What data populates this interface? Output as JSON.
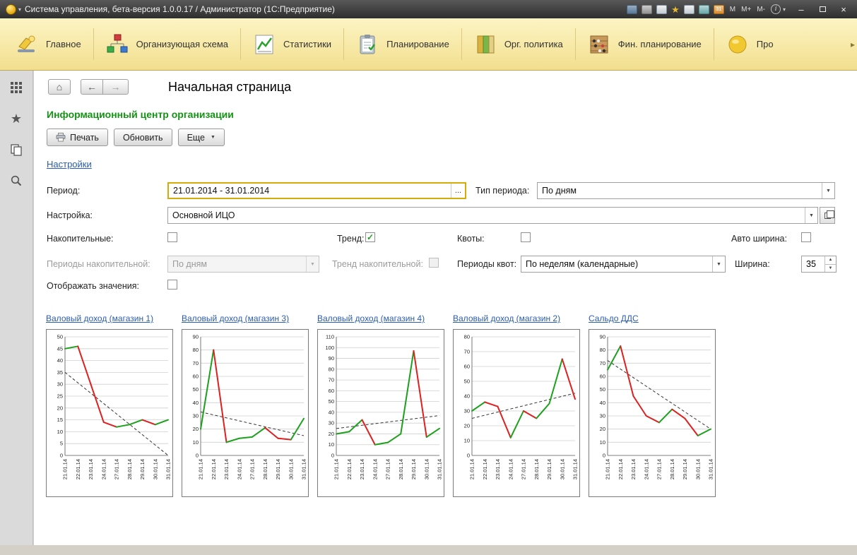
{
  "colors": {
    "heading_green": "#149414",
    "link_blue": "#2a5db0",
    "series_green": "#1ba11b",
    "series_red": "#e01f1f",
    "trend_dark": "#333333",
    "focus_yellow": "#d3ac0c"
  },
  "titlebar": {
    "title": "Система управления, бета-версия 1.0.0.17 / Администратор  (1С:Предприятие)",
    "calendar_day": "31",
    "memory_buttons": [
      "M",
      "M+",
      "M-"
    ],
    "minimize": "–",
    "close": "×"
  },
  "ribbon": {
    "items": [
      {
        "label": "Главное"
      },
      {
        "label": "Организующая схема"
      },
      {
        "label": "Статистики"
      },
      {
        "label": "Планирование"
      },
      {
        "label": "Орг. политика"
      },
      {
        "label": "Фин. планирование"
      },
      {
        "label": "Про"
      }
    ]
  },
  "nav": {
    "page_title": "Начальная страница"
  },
  "content": {
    "heading": "Информационный центр организации",
    "print_button": "Печать",
    "refresh_button": "Обновить",
    "more_button": "Еще",
    "settings_link": "Настройки"
  },
  "form": {
    "period": {
      "label": "Период:",
      "value": "21.01.2014 - 31.01.2014",
      "ellipsis": "..."
    },
    "period_type": {
      "label": "Тип периода:",
      "value": "По дням"
    },
    "setting": {
      "label": "Настройка:",
      "value": "Основной ИЦО"
    },
    "cumulative": {
      "label": "Накопительные:",
      "checked": false
    },
    "trend": {
      "label": "Тренд:",
      "checked": true
    },
    "quotas": {
      "label": "Квоты:",
      "checked": false
    },
    "auto_width": {
      "label": "Авто ширина:",
      "checked": false
    },
    "cumulative_periods": {
      "label": "Периоды накопительной:",
      "value": "По дням",
      "disabled": true
    },
    "trend_cumulative": {
      "label": "Тренд накопительной:",
      "checked": false,
      "disabled": true
    },
    "quota_periods": {
      "label": "Периоды квот:",
      "value": "По неделям (календарные)"
    },
    "width": {
      "label": "Ширина:",
      "value": "35"
    },
    "show_values": {
      "label": "Отображать значения:",
      "checked": false
    }
  },
  "chart_data": {
    "type": "line",
    "categories": [
      "21.01.14",
      "22.01.14",
      "23.01.14",
      "24.01.14",
      "27.01.14",
      "28.01.14",
      "29.01.14",
      "30.01.14",
      "31.01.14"
    ],
    "legend": "none",
    "grid": true,
    "charts": [
      {
        "title": "Валовый доход (магазин 1)",
        "ymin": 0,
        "ymax": 50,
        "ystep": 5,
        "values": [
          45,
          46,
          30,
          14,
          12,
          13,
          15,
          13,
          15
        ],
        "trend": [
          35,
          0
        ]
      },
      {
        "title": "Валовый доход (магазин 3)",
        "ymin": 0,
        "ymax": 90,
        "ystep": 10,
        "values": [
          20,
          80,
          10,
          13,
          14,
          21,
          13,
          12,
          28
        ],
        "trend": [
          33,
          15
        ]
      },
      {
        "title": "Валовый доход (магазин 4)",
        "ymin": 0,
        "ymax": 110,
        "ystep": 10,
        "values": [
          20,
          22,
          33,
          10,
          12,
          20,
          97,
          17,
          25
        ],
        "trend": [
          25,
          37
        ]
      },
      {
        "title": "Валовый доход (магазин 2)",
        "ymin": 0,
        "ymax": 80,
        "ystep": 10,
        "values": [
          30,
          36,
          33,
          12,
          30,
          25,
          35,
          65,
          38
        ],
        "trend": [
          25,
          42
        ]
      },
      {
        "title": "Сальдо ДДС",
        "ymin": 0,
        "ymax": 90,
        "ystep": 10,
        "values": [
          65,
          83,
          45,
          30,
          25,
          35,
          28,
          15,
          20
        ],
        "trend": [
          72,
          20
        ]
      }
    ]
  }
}
